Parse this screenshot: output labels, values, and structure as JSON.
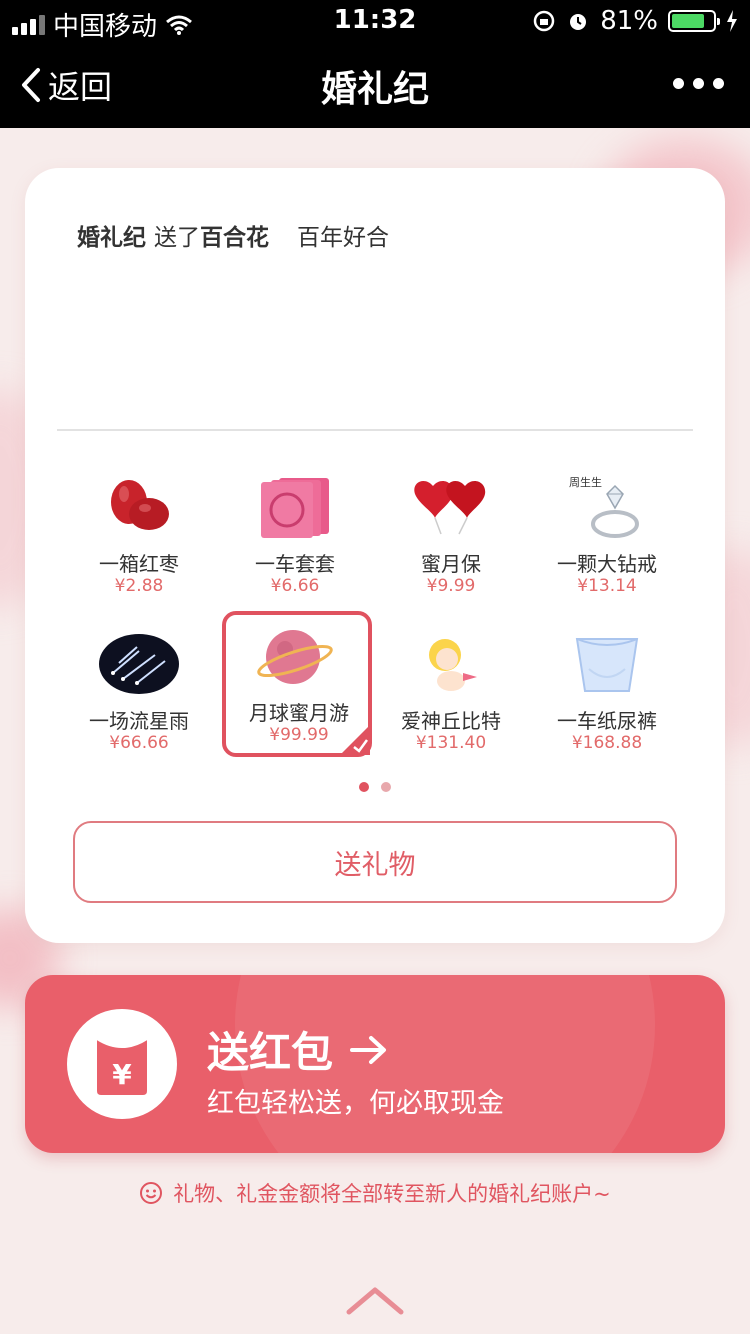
{
  "status_bar": {
    "carrier": "中国移动",
    "time": "11:32",
    "battery_percent": "81%",
    "battery_level": 0.81
  },
  "nav": {
    "back_label": "返回",
    "title": "婚礼纪"
  },
  "message": {
    "sender": "婚礼纪",
    "verb": "送了",
    "gift": "百合花",
    "wish": "百年好合"
  },
  "gifts": [
    {
      "name": "一箱红枣",
      "price": "¥2.88",
      "icon": "red-dates-icon"
    },
    {
      "name": "一车套套",
      "price": "¥6.66",
      "icon": "condom-icon"
    },
    {
      "name": "蜜月保",
      "price": "¥9.99",
      "icon": "hearts-icon"
    },
    {
      "name": "一颗大钻戒",
      "price": "¥13.14",
      "icon": "diamond-ring-icon",
      "brand": "周生生"
    },
    {
      "name": "一场流星雨",
      "price": "¥66.66",
      "icon": "meteor-shower-icon"
    },
    {
      "name": "月球蜜月游",
      "price": "¥99.99",
      "icon": "moon-trip-icon",
      "selected": true
    },
    {
      "name": "爱神丘比特",
      "price": "¥131.40",
      "icon": "cupid-icon"
    },
    {
      "name": "一车纸尿裤",
      "price": "¥168.88",
      "icon": "diaper-icon"
    }
  ],
  "pagination": {
    "current": 1,
    "total": 2
  },
  "send_gift_label": "送礼物",
  "red_packet": {
    "title": "送红包",
    "subtitle": "红包轻松送，何必取现金",
    "icon_symbol": "¥"
  },
  "notice": "礼物、礼金金额将全部转至新人的婚礼纪账户~",
  "colors": {
    "accent": "#e95f6a",
    "price": "#e26a6a",
    "background": "#f7eceb"
  }
}
